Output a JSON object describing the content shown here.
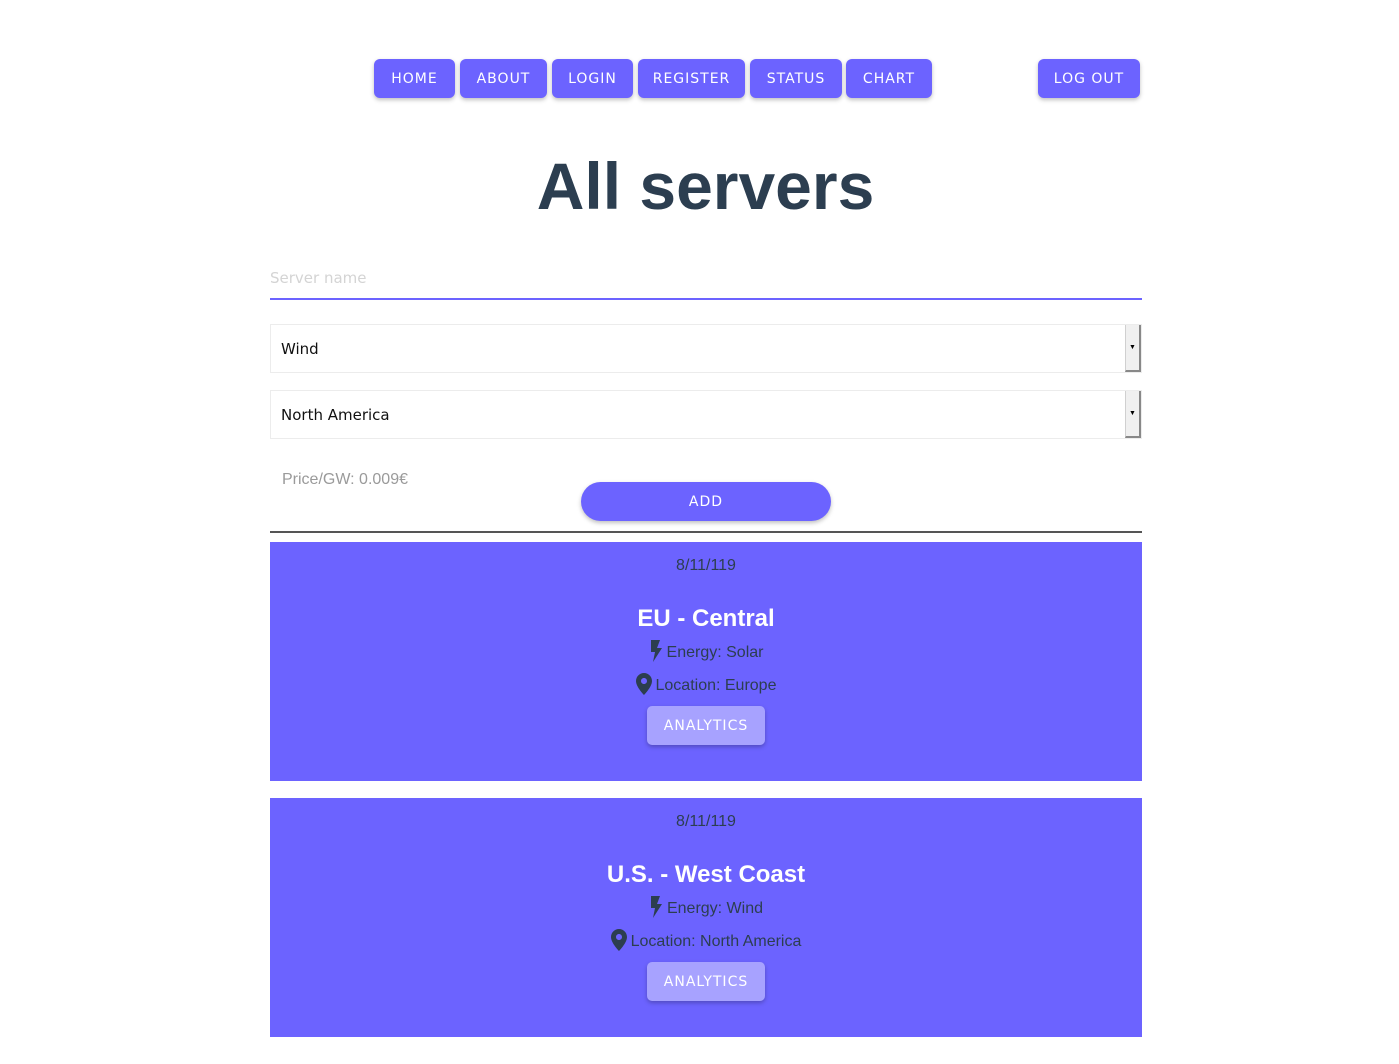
{
  "nav": {
    "home": "HOME",
    "about": "ABOUT",
    "login": "LOGIN",
    "register": "REGISTER",
    "status": "STATUS",
    "chart": "CHART",
    "logout": "LOG OUT"
  },
  "page_title": "All servers",
  "form": {
    "name_placeholder": "Server name",
    "name_value": "",
    "energy_select": "Wind",
    "location_select": "North America",
    "price": "Price/GW: 0.009€",
    "add_label": "ADD"
  },
  "servers": [
    {
      "date": "8/11/119",
      "name": "EU - Central",
      "energy": "Energy: Solar",
      "location": "Location: Europe",
      "analytics_label": "ANALYTICS"
    },
    {
      "date": "8/11/119",
      "name": "U.S. - West Coast",
      "energy": "Energy: Wind",
      "location": "Location: North America",
      "analytics_label": "ANALYTICS"
    }
  ],
  "colors": {
    "accent": "#6c63ff",
    "accent_light": "#a7a2ff",
    "title": "#2c3e50"
  },
  "icons": {
    "energy": "bolt-icon",
    "location": "map-pin-icon"
  }
}
